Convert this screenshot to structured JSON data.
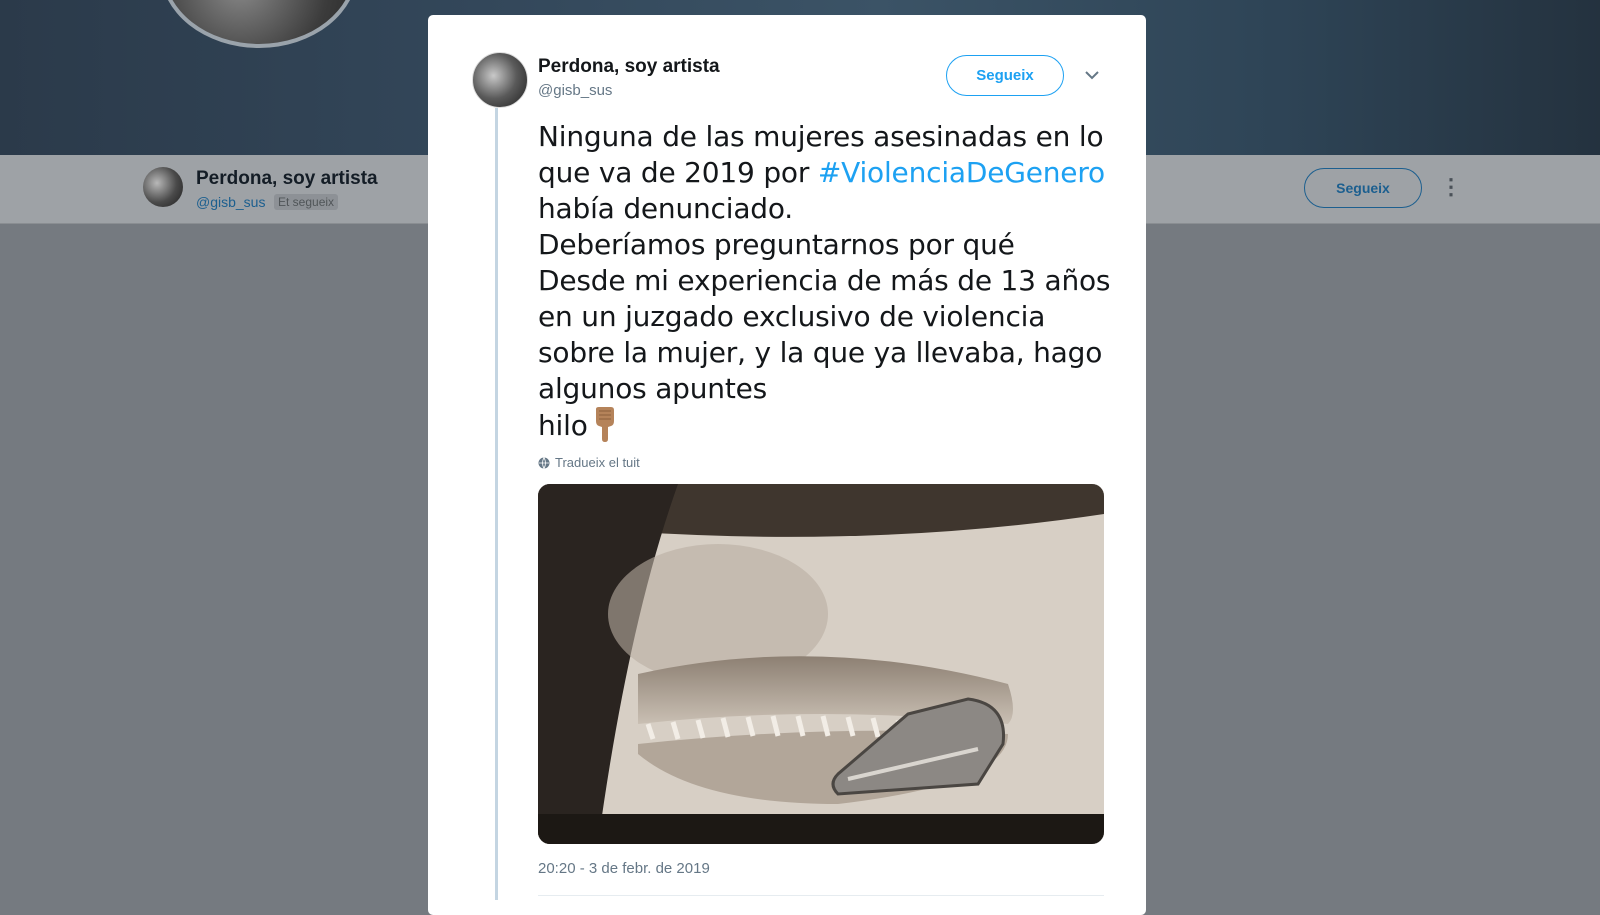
{
  "background_profile": {
    "name": "Perdona, soy artista",
    "handle": "@gisb_sus",
    "follows_you": "Et segueix",
    "follow_label": "Segueix",
    "more_icon": "more-vertical-icon"
  },
  "tweet": {
    "author_name": "Perdona, soy artista",
    "author_handle": "@gisb_sus",
    "follow_label": "Segueix",
    "caret_icon": "chevron-down-icon",
    "text_part1": "Ninguna de las mujeres asesinadas en lo\nque va de 2019 por ",
    "hashtag": "#ViolenciaDeGenero",
    "text_part2": "\nhabía denunciado.\nDeberíamos preguntarnos por qué\nDesde mi experiencia de más de 13 años\nen un juzgado exclusivo de violencia\nsobre la mujer, y la que ya llevaba, hago\nalgunos apuntes\nhilo",
    "emoji_icon": "pointing-down-icon",
    "translate_label": "Tradueix el tuit",
    "translate_icon": "globe-icon",
    "timestamp": "20:20 - 3 de febr. de 2019"
  },
  "colors": {
    "accent": "#1da1f2",
    "text": "#14171a",
    "muted": "#657786"
  }
}
